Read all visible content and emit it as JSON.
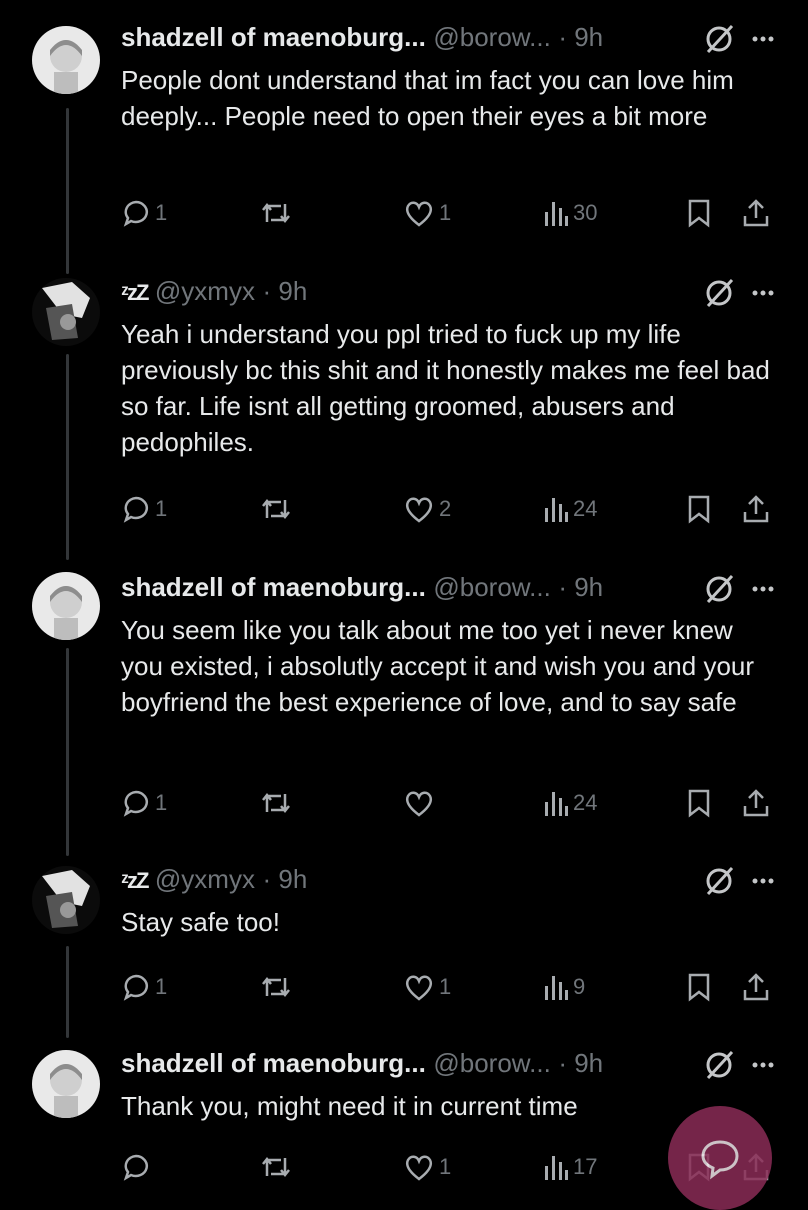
{
  "tweets": [
    {
      "name": "shadzell of maenoburg...",
      "handle": "@borow...",
      "time": "· 9h",
      "text": "People dont understand that im fact you can love him deeply... People need to open their eyes a bit more",
      "replies": "1",
      "reposts": "",
      "likes": "1",
      "views": "30"
    },
    {
      "name": "ᶻzZ",
      "handle": "@yxmyx",
      "time": "· 9h",
      "text": "Yeah i understand you ppl tried to fuck up my life previously bc this shit and it honestly makes me feel bad so far. Life isnt all getting groomed, abusers and pedophiles.",
      "replies": "1",
      "reposts": "",
      "likes": "2",
      "views": "24"
    },
    {
      "name": "shadzell of maenoburg...",
      "handle": "@borow...",
      "time": "· 9h",
      "text": "You seem like you talk about me too yet i never knew you existed, i absolutly accept it and wish you and your boyfriend the best experience of love, and to say safe",
      "replies": "1",
      "reposts": "",
      "likes": "",
      "views": "24"
    },
    {
      "name": "ᶻzZ",
      "handle": "@yxmyx",
      "time": "· 9h",
      "text": "Stay safe too!",
      "replies": "1",
      "reposts": "",
      "likes": "1",
      "views": "9"
    },
    {
      "name": "shadzell of maenoburg...",
      "handle": "@borow...",
      "time": "· 9h",
      "text": "Thank you, might need it in current time",
      "replies": "",
      "reposts": "",
      "likes": "1",
      "views": "17"
    }
  ],
  "icons": {
    "reply": "reply-icon",
    "repost": "repost-icon",
    "like": "like-icon",
    "views": "views-icon",
    "bookmark": "bookmark-icon",
    "share": "share-icon",
    "grok": "grok-icon",
    "more": "more-icon",
    "compose": "compose-fab-icon"
  },
  "colors": {
    "background": "#000000",
    "text": "#e7e9ea",
    "muted": "#71767b",
    "fab": "#8a2c56"
  }
}
